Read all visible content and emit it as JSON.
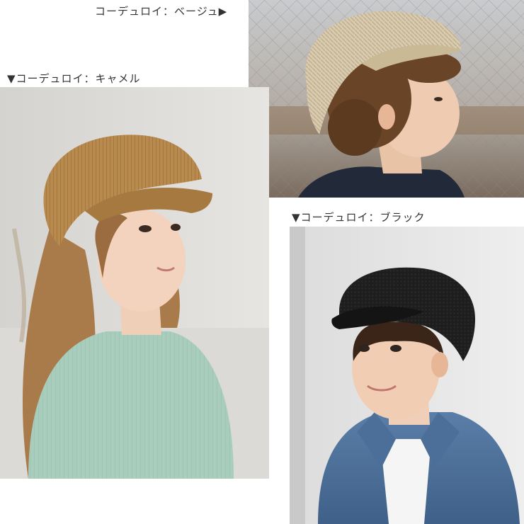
{
  "labels": {
    "beige": "コーデュロイ：ベージュ▶",
    "camel": "▼コーデュロイ：キャメル",
    "black": "▼コーデュロイ：ブラック"
  },
  "photos": [
    {
      "name": "photo-beige-corduroy-cap",
      "cap_color": "#d8cbb0"
    },
    {
      "name": "photo-camel-corduroy-cap",
      "cap_color": "#b88a4e"
    },
    {
      "name": "photo-black-corduroy-cap",
      "cap_color": "#1e1e1e"
    }
  ]
}
